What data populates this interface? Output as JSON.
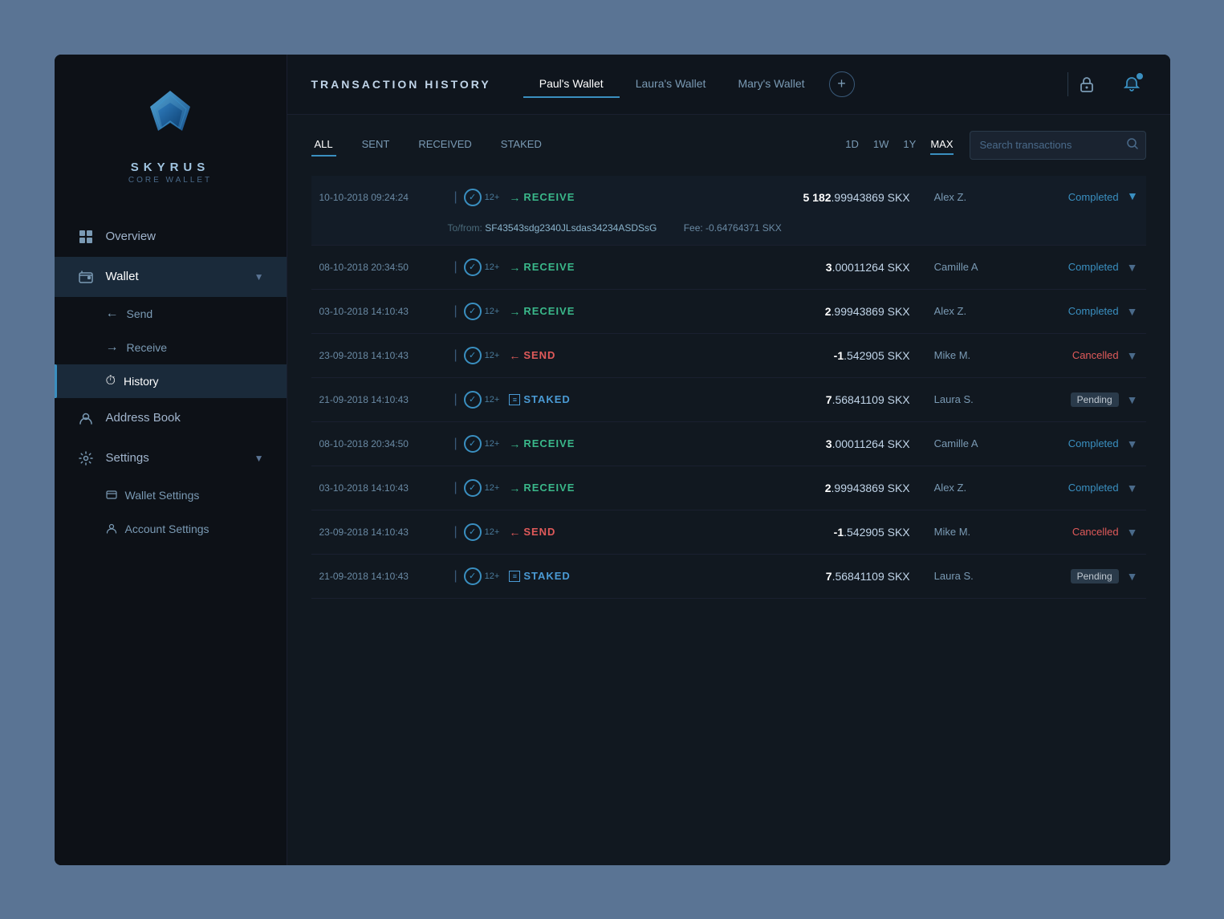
{
  "app": {
    "brand": "SKYRUS",
    "subbrand": "CORE WALLET"
  },
  "sidebar": {
    "nav_items": [
      {
        "id": "overview",
        "label": "Overview",
        "icon": "grid",
        "active": false
      },
      {
        "id": "wallet",
        "label": "Wallet",
        "icon": "wallet",
        "active": true,
        "has_chevron": true
      }
    ],
    "wallet_sub": [
      {
        "id": "send",
        "label": "Send",
        "icon": "←",
        "active": false
      },
      {
        "id": "receive",
        "label": "Receive",
        "icon": "→",
        "active": false
      },
      {
        "id": "history",
        "label": "History",
        "icon": "⏱",
        "active": true
      }
    ],
    "address_book": {
      "label": "Address Book",
      "icon": "person"
    },
    "settings": {
      "label": "Settings",
      "icon": "gear",
      "has_chevron": true,
      "sub": [
        {
          "id": "wallet-settings",
          "label": "Wallet Settings",
          "icon": "wallet-s"
        },
        {
          "id": "account-settings",
          "label": "Account Settings",
          "icon": "person-s"
        }
      ]
    }
  },
  "topbar": {
    "title": "TRANSACTION HISTORY",
    "wallets": [
      {
        "id": "pauls",
        "label": "Paul's Wallet",
        "active": true
      },
      {
        "id": "lauras",
        "label": "Laura's Wallet",
        "active": false
      },
      {
        "id": "marys",
        "label": "Mary's Wallet",
        "active": false
      }
    ],
    "add_btn": "+",
    "lock_icon": "🔒",
    "notif_icon": "🔔"
  },
  "filters": {
    "type_tabs": [
      {
        "id": "all",
        "label": "ALL",
        "active": true
      },
      {
        "id": "sent",
        "label": "SENT",
        "active": false
      },
      {
        "id": "received",
        "label": "RECEIVED",
        "active": false
      },
      {
        "id": "staked",
        "label": "STAKED",
        "active": false
      }
    ],
    "time_tabs": [
      {
        "id": "1d",
        "label": "1D",
        "active": false
      },
      {
        "id": "1w",
        "label": "1W",
        "active": false
      },
      {
        "id": "1y",
        "label": "1Y",
        "active": false
      },
      {
        "id": "max",
        "label": "MAX",
        "active": true
      }
    ],
    "search_placeholder": "Search transactions"
  },
  "transactions": [
    {
      "id": 1,
      "date": "10-10-2018 09:24:24",
      "confirms": "12+",
      "type": "RECEIVE",
      "type_class": "receive",
      "amount_main": "5 182",
      "amount_frac": ".99943869",
      "currency": "SKX",
      "contact": "Alex Z.",
      "status": "Completed",
      "status_class": "completed",
      "expanded": true,
      "from_label": "To/from:",
      "from_addr": "SF43543sdg2340JLsdas34234ASDSsG",
      "fee_label": "Fee:",
      "fee_value": "-0.64764371 SKX"
    },
    {
      "id": 2,
      "date": "08-10-2018 20:34:50",
      "confirms": "12+",
      "type": "RECEIVE",
      "type_class": "receive",
      "amount_main": "3",
      "amount_frac": ".00011264",
      "currency": "SKX",
      "contact": "Camille A",
      "status": "Completed",
      "status_class": "completed",
      "expanded": false
    },
    {
      "id": 3,
      "date": "03-10-2018 14:10:43",
      "confirms": "12+",
      "type": "RECEIVE",
      "type_class": "receive",
      "amount_main": "2",
      "amount_frac": ".99943869",
      "currency": "SKX",
      "contact": "Alex Z.",
      "status": "Completed",
      "status_class": "completed",
      "expanded": false
    },
    {
      "id": 4,
      "date": "23-09-2018 14:10:43",
      "confirms": "12+",
      "type": "SEND",
      "type_class": "send",
      "amount_main": "-1",
      "amount_frac": ".542905",
      "currency": "SKX",
      "contact": "Mike M.",
      "status": "Cancelled",
      "status_class": "cancelled",
      "expanded": false
    },
    {
      "id": 5,
      "date": "21-09-2018 14:10:43",
      "confirms": "12+",
      "type": "STAKED",
      "type_class": "staked",
      "amount_main": "7",
      "amount_frac": ".56841109",
      "currency": "SKX",
      "contact": "Laura S.",
      "status": "Pending",
      "status_class": "pending",
      "expanded": false
    },
    {
      "id": 6,
      "date": "08-10-2018 20:34:50",
      "confirms": "12+",
      "type": "RECEIVE",
      "type_class": "receive",
      "amount_main": "3",
      "amount_frac": ".00011264",
      "currency": "SKX",
      "contact": "Camille A",
      "status": "Completed",
      "status_class": "completed",
      "expanded": false
    },
    {
      "id": 7,
      "date": "03-10-2018 14:10:43",
      "confirms": "12+",
      "type": "RECEIVE",
      "type_class": "receive",
      "amount_main": "2",
      "amount_frac": ".99943869",
      "currency": "SKX",
      "contact": "Alex Z.",
      "status": "Completed",
      "status_class": "completed",
      "expanded": false
    },
    {
      "id": 8,
      "date": "23-09-2018 14:10:43",
      "confirms": "12+",
      "type": "SEND",
      "type_class": "send",
      "amount_main": "-1",
      "amount_frac": ".542905",
      "currency": "SKX",
      "contact": "Mike M.",
      "status": "Cancelled",
      "status_class": "cancelled",
      "expanded": false
    },
    {
      "id": 9,
      "date": "21-09-2018 14:10:43",
      "confirms": "12+",
      "type": "STAKED",
      "type_class": "staked",
      "amount_main": "7",
      "amount_frac": ".56841109",
      "currency": "SKX",
      "contact": "Laura S.",
      "status": "Pending",
      "status_class": "pending",
      "expanded": false
    }
  ]
}
